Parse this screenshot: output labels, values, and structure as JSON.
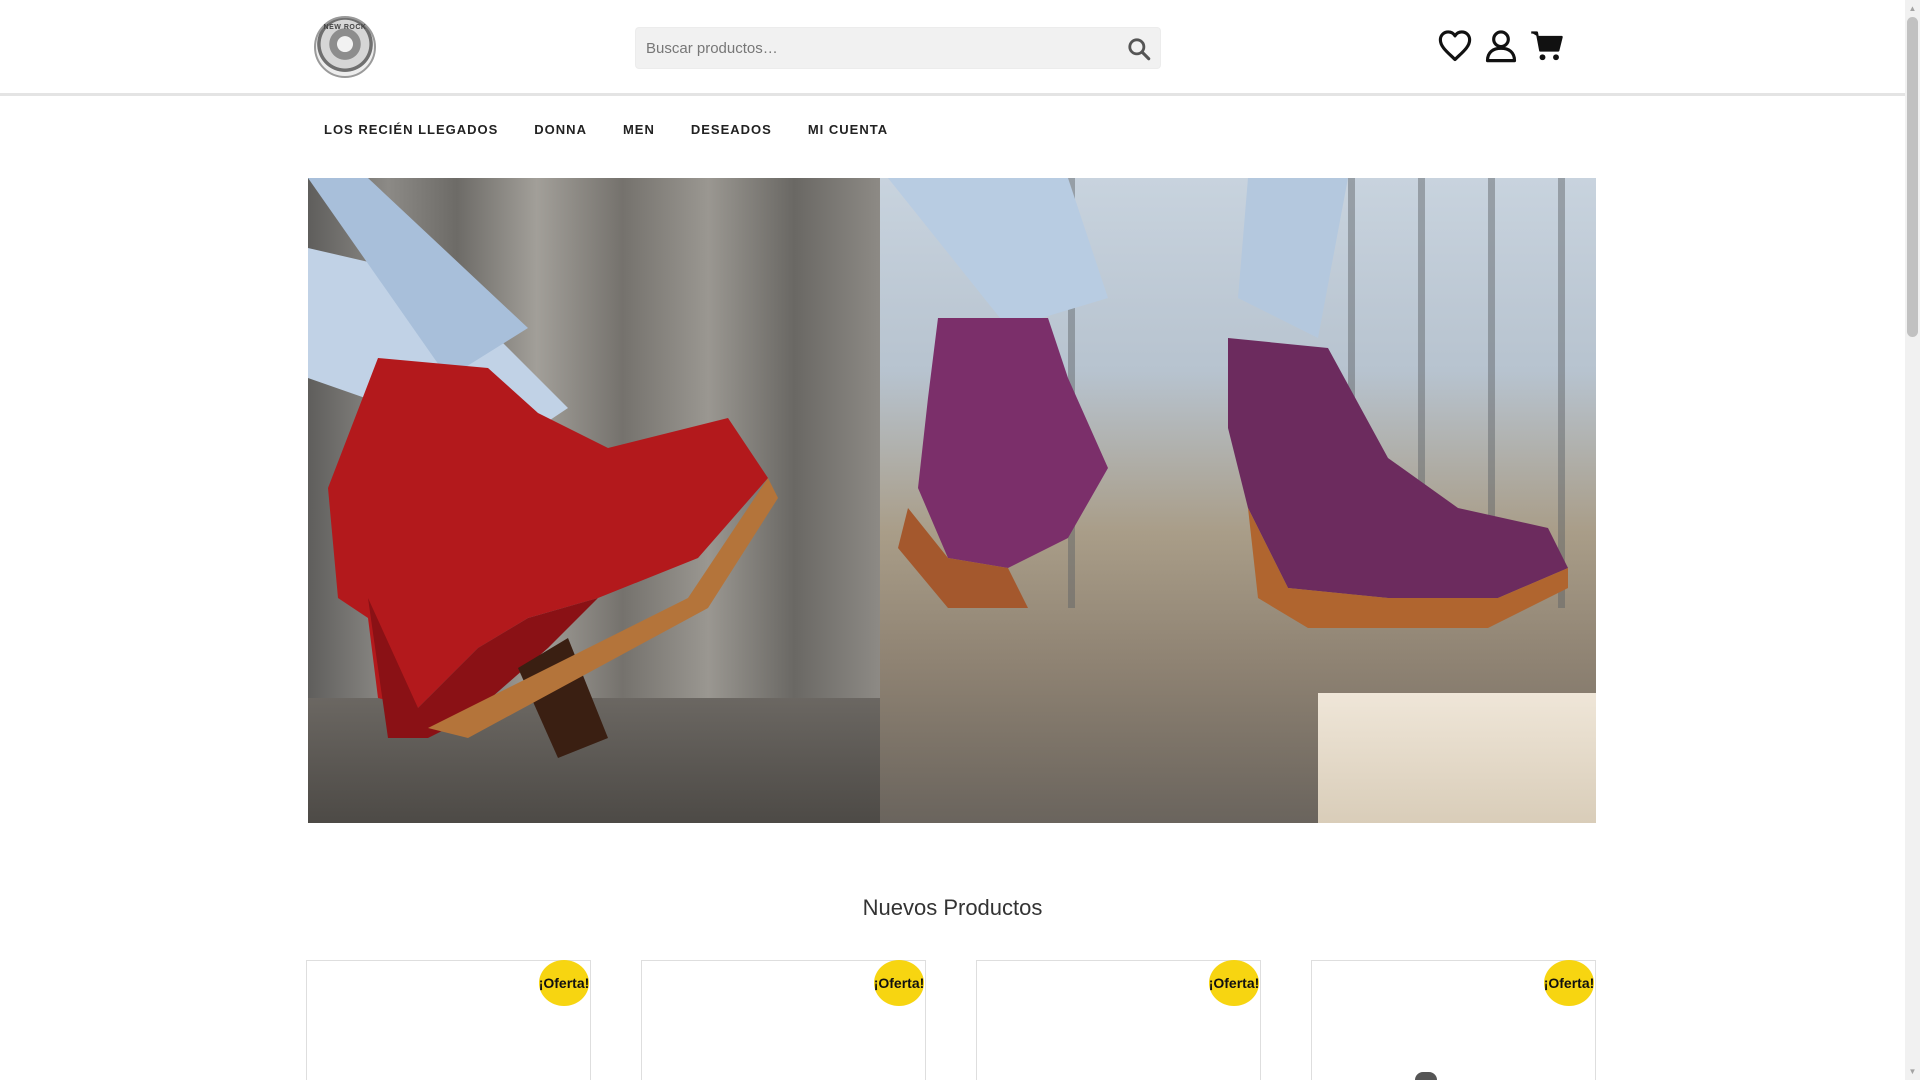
{
  "header": {
    "logo_text": "NEW ROCK",
    "search": {
      "placeholder": "Buscar productos…",
      "value": ""
    },
    "icons": [
      "heart-icon",
      "user-icon",
      "cart-icon"
    ]
  },
  "nav": {
    "items": [
      {
        "label": "LOS RECIÉN LLEGADOS"
      },
      {
        "label": "DONNA"
      },
      {
        "label": "MEN"
      },
      {
        "label": "DESEADOS"
      },
      {
        "label": "MI CUENTA"
      }
    ]
  },
  "hero": {
    "image": "boots-banner"
  },
  "new_products": {
    "title": "Nuevos Productos",
    "cards": [
      {
        "badge": "¡Oferta!"
      },
      {
        "badge": "¡Oferta!"
      },
      {
        "badge": "¡Oferta!"
      },
      {
        "badge": "¡Oferta!"
      }
    ]
  },
  "colors": {
    "badge": "#f7d511",
    "text": "#222222",
    "search_bg": "#f1f1f1"
  }
}
